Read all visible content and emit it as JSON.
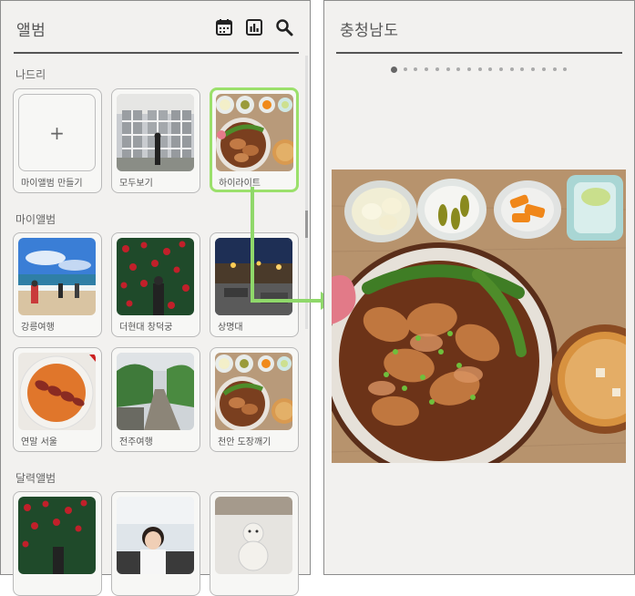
{
  "left": {
    "title": "앨범",
    "icons": [
      "calendar-icon",
      "bar-chart-icon",
      "search-icon"
    ],
    "sections": {
      "shared": "나드리",
      "mine": "마이앨범",
      "calendar": "달력앨범"
    },
    "shared_items": [
      {
        "label": "마이앨범 만들기",
        "icon": "plus-icon"
      },
      {
        "label": "모두보기"
      },
      {
        "label": "하이라이트",
        "highlighted": true
      }
    ],
    "my_items": [
      {
        "label": "강릉여행"
      },
      {
        "label": "더현대 창덕궁"
      },
      {
        "label": "상명대"
      },
      {
        "label": "연말 서울"
      },
      {
        "label": "전주여행"
      },
      {
        "label": "천안 도장깨기"
      }
    ],
    "calendar_items": [
      {
        "label": ""
      },
      {
        "label": ""
      },
      {
        "label": ""
      }
    ],
    "plus_symbol": "+"
  },
  "right": {
    "title": "충청남도",
    "page_total": 17,
    "page_current": 1
  },
  "colors": {
    "highlight": "#9be06b",
    "arrow": "#8fd86a",
    "panel_bg": "#f2f1ef"
  }
}
